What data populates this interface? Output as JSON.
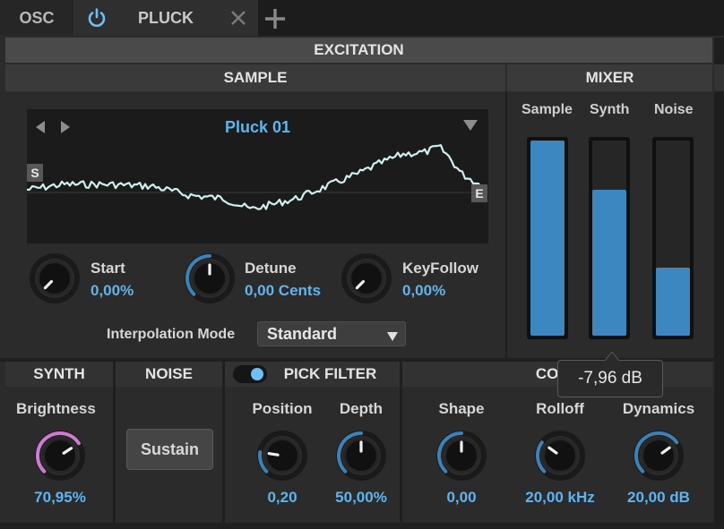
{
  "tabs": {
    "osc": "OSC",
    "pluck": "PLUCK"
  },
  "headers": {
    "excitation": "EXCITATION",
    "sample": "SAMPLE",
    "mixer": "MIXER"
  },
  "sample": {
    "name": "Pluck 01",
    "start_marker": "S",
    "end_marker": "E",
    "interpolation_label": "Interpolation Mode",
    "interpolation_value": "Standard"
  },
  "sample_knobs": [
    {
      "label": "Start",
      "value": "0,00%",
      "level": 0.0
    },
    {
      "label": "Detune",
      "value": "0,00 Cents",
      "level": 0.5
    },
    {
      "label": "KeyFollow",
      "value": "0,00%",
      "level": 0.0
    }
  ],
  "mixer": {
    "channels": [
      {
        "label": "Sample",
        "level": 1.0
      },
      {
        "label": "Synth",
        "level": 0.75
      },
      {
        "label": "Noise",
        "level": 0.35
      }
    ],
    "tooltip": "-7,96 dB"
  },
  "sections": {
    "synth": "SYNTH",
    "noise": "NOISE",
    "pick_filter": "PICK FILTER",
    "controls": "CONT"
  },
  "synth": {
    "label": "Brightness",
    "value": "70,95%",
    "level": 0.71
  },
  "noise": {
    "button": "Sustain"
  },
  "pick_filter": [
    {
      "label": "Position",
      "value": "0,20",
      "level": 0.2
    },
    {
      "label": "Depth",
      "value": "50,00%",
      "level": 0.5
    }
  ],
  "controls": [
    {
      "label": "Shape",
      "value": "0,00",
      "level": 0.5
    },
    {
      "label": "Rolloff",
      "value": "20,00 kHz",
      "level": 0.3
    },
    {
      "label": "Dynamics",
      "value": "20,00 dB",
      "level": 0.7
    }
  ],
  "colors": {
    "accent": "#5fb4ee",
    "fader": "#3c87c0",
    "brightness_ring": "#d07ad6",
    "waveform": "#cfeeee"
  }
}
